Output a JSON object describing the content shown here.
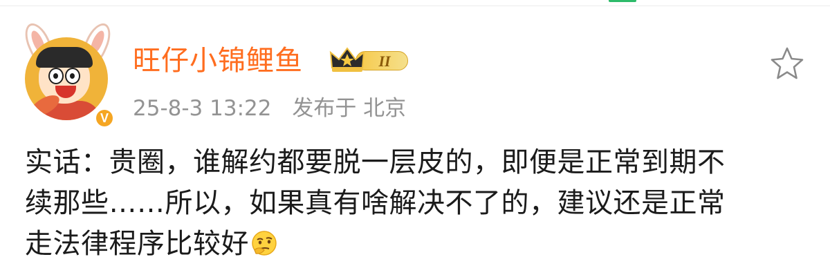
{
  "post": {
    "username": "旺仔小锦鲤鱼",
    "level": "II",
    "timestamp": "25-8-3 13:22",
    "location": "发布于 北京",
    "body_lines": [
      "实话：贵圈，谁解约都要脱一层皮的，即便是正常到期不",
      "续那些……所以，如果真有啥解决不了的，建议还是正常",
      "走法律程序比较好"
    ],
    "emoji": "thinking-emoji",
    "icons": {
      "favorite": "star-icon",
      "verified": "verified-v-icon",
      "level": "crown-icon"
    },
    "colors": {
      "username": "#ff6d1f",
      "meta": "#939393",
      "text": "#1b1b1b",
      "verified": "#f5a623"
    }
  }
}
